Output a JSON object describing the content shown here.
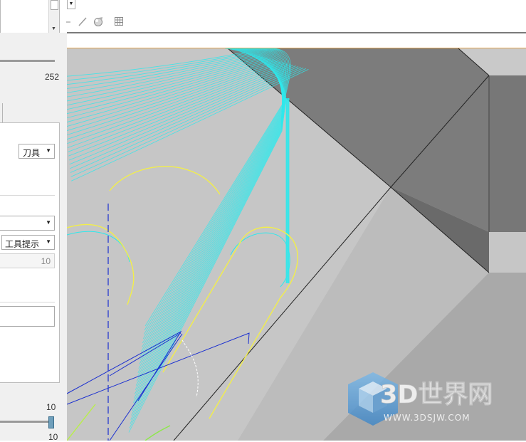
{
  "toolbar": {
    "icons": [
      "line-icon",
      "sphere-icon",
      "grid-icon"
    ]
  },
  "panel": {
    "slider1_value": "252",
    "tool_combo": "刀具",
    "tooltip_combo": "工具提示",
    "readonly_value": "10",
    "slider2_label": "10",
    "slider2_label_bottom": "10",
    "slider2_level_percent": 100
  },
  "watermark": {
    "main": "3D世界网",
    "sub": "WWW.3DSJW.COM",
    "logo": "cube-logo-icon"
  },
  "colors": {
    "toolpath": "#2ee8ec",
    "boundary": "#ffef3a",
    "link": "#1a2fd0",
    "surface_light": "#c4c4c4",
    "surface_dark": "#7c7c7c",
    "accent_line": "#e5a34a"
  }
}
